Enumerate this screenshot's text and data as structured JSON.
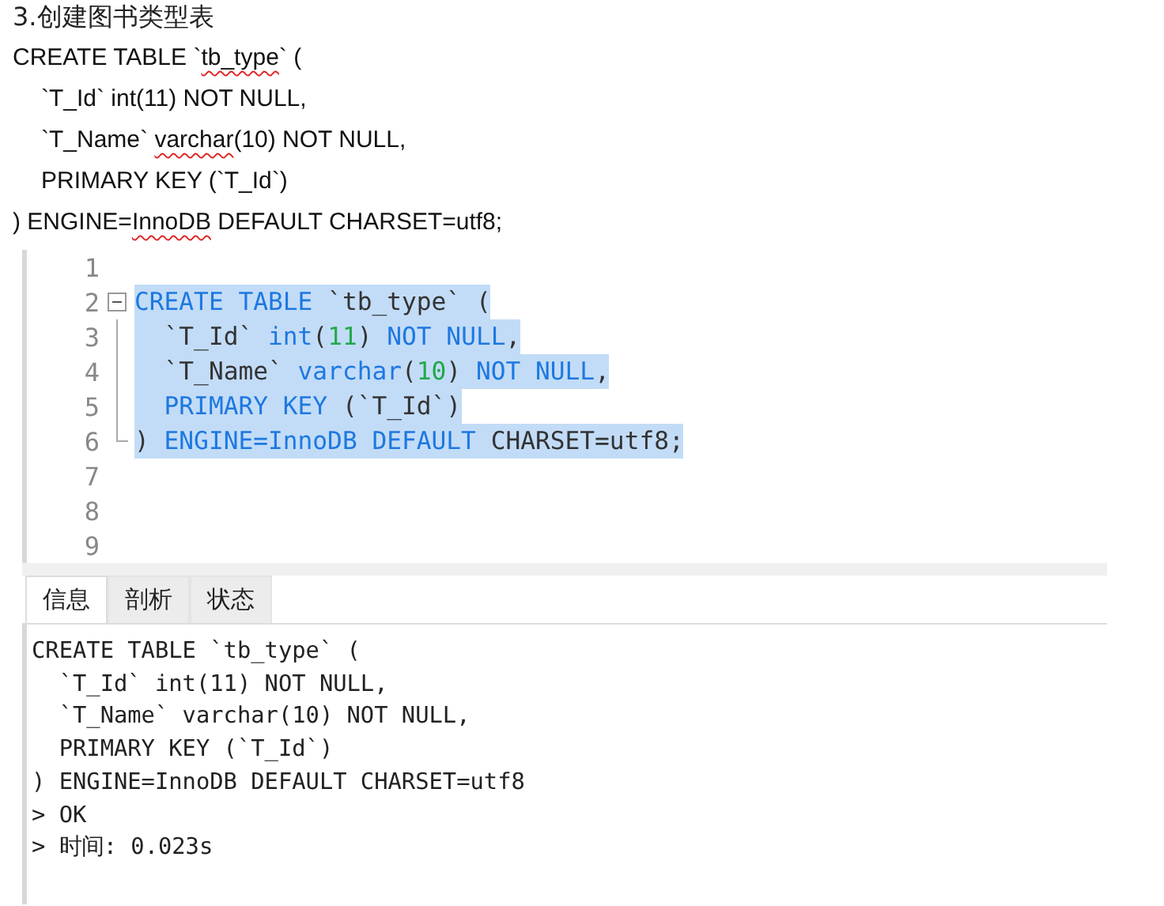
{
  "doc": {
    "heading": "3.创建图书类型表",
    "lines": [
      [
        {
          "text": "CREATE TABLE `",
          "misspelled": false
        },
        {
          "text": "tb_type",
          "misspelled": true
        },
        {
          "text": "` (",
          "misspelled": false
        }
      ],
      [
        {
          "text": "`T_Id` int(11) NOT NULL,",
          "misspelled": false
        }
      ],
      [
        {
          "text": "`T_Name` ",
          "misspelled": false
        },
        {
          "text": "varchar",
          "misspelled": true
        },
        {
          "text": "(10) NOT NULL,",
          "misspelled": false
        }
      ],
      [
        {
          "text": "PRIMARY KEY (`T_Id`)",
          "misspelled": false
        }
      ],
      [
        {
          "text": ") ENGINE=",
          "misspelled": false
        },
        {
          "text": "InnoDB",
          "misspelled": true
        },
        {
          "text": " DEFAULT CHARSET=utf8;",
          "misspelled": false
        }
      ]
    ]
  },
  "editor": {
    "lines": [
      {
        "number": "1"
      },
      {
        "number": "2",
        "selected": true,
        "tokens": [
          {
            "kind": "keyword",
            "text": "CREATE TABLE"
          },
          {
            "kind": "plain",
            "text": " `tb_type` ("
          }
        ]
      },
      {
        "number": "3",
        "selected": true,
        "tokens": [
          {
            "kind": "plain",
            "text": "  `T_Id` "
          },
          {
            "kind": "keyword",
            "text": "int"
          },
          {
            "kind": "plain",
            "text": "("
          },
          {
            "kind": "number",
            "text": "11"
          },
          {
            "kind": "plain",
            "text": ") "
          },
          {
            "kind": "keyword",
            "text": "NOT NULL"
          },
          {
            "kind": "plain",
            "text": ","
          }
        ]
      },
      {
        "number": "4",
        "selected": true,
        "tokens": [
          {
            "kind": "plain",
            "text": "  `T_Name` "
          },
          {
            "kind": "keyword",
            "text": "varchar"
          },
          {
            "kind": "plain",
            "text": "("
          },
          {
            "kind": "number",
            "text": "10"
          },
          {
            "kind": "plain",
            "text": ") "
          },
          {
            "kind": "keyword",
            "text": "NOT NULL"
          },
          {
            "kind": "plain",
            "text": ","
          }
        ]
      },
      {
        "number": "5",
        "selected": true,
        "tokens": [
          {
            "kind": "keyword",
            "text": "  PRIMARY KEY"
          },
          {
            "kind": "plain",
            "text": " (`T_Id`)"
          }
        ]
      },
      {
        "number": "6",
        "selected": true,
        "tokens": [
          {
            "kind": "plain",
            "text": ") "
          },
          {
            "kind": "keyword",
            "text": "ENGINE=InnoDB DEFAULT"
          },
          {
            "kind": "plain",
            "text": " CHARSET=utf8;"
          }
        ]
      },
      {
        "number": "7"
      },
      {
        "number": "8"
      },
      {
        "number": "9"
      }
    ]
  },
  "tabs": [
    {
      "label": "信息",
      "selected": true
    },
    {
      "label": "剖析",
      "selected": false
    },
    {
      "label": "状态",
      "selected": false
    }
  ],
  "output": [
    "CREATE TABLE `tb_type` (",
    "  `T_Id` int(11) NOT NULL,",
    "  `T_Name` varchar(10) NOT NULL,",
    "  PRIMARY KEY (`T_Id`)",
    ") ENGINE=InnoDB DEFAULT CHARSET=utf8",
    "> OK",
    "> 时间: 0.023s"
  ]
}
